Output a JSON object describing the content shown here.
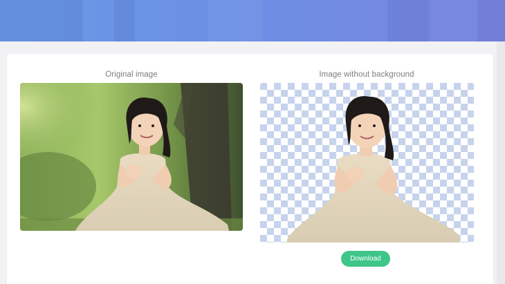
{
  "colors": {
    "page_background": "#f2f2f4",
    "card_background": "#ffffff",
    "caption_text": "#7d7d7d",
    "checker_light": "#ffffff",
    "checker_dark": "#c7d3ec",
    "download_button": "#3ec58a"
  },
  "panels": {
    "original": {
      "label": "Original image",
      "icon": "photo-girl-in-garden"
    },
    "result": {
      "label": "Image without background",
      "icon": "photo-girl-cutout"
    }
  },
  "actions": {
    "download_label": "Download"
  }
}
